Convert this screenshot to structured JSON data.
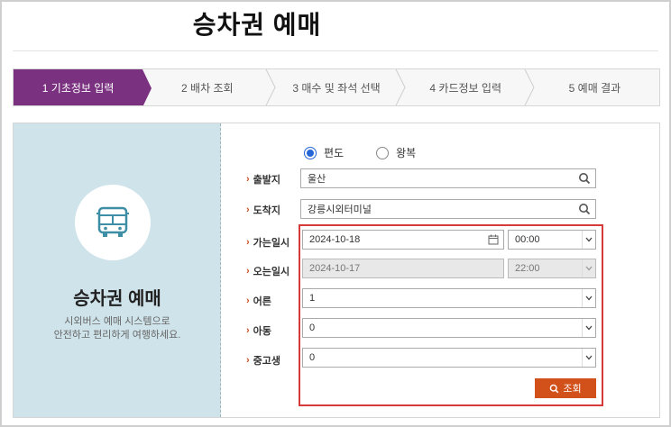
{
  "page": {
    "title": "승차권 예매"
  },
  "steps": [
    {
      "label": "1 기초정보 입력"
    },
    {
      "label": "2 배차 조회"
    },
    {
      "label": "3 매수 및 좌석 선택"
    },
    {
      "label": "4 카드정보 입력"
    },
    {
      "label": "5 예매 결과"
    }
  ],
  "intro": {
    "icon": "bus-icon",
    "title": "승차권 예매",
    "desc_line1": "시외버스 예매 시스템으로",
    "desc_line2": "안전하고 편리하게 여행하세요."
  },
  "trip_type": {
    "one_way": "편도",
    "round_trip": "왕복",
    "selected": "편도"
  },
  "form": {
    "departure": {
      "label": "출발지",
      "value": "울산"
    },
    "arrival": {
      "label": "도착지",
      "value": "강릉시외터미널"
    },
    "go_date": {
      "label": "가는일시",
      "date": "2024-10-18",
      "time": "00:00"
    },
    "return_date": {
      "label": "오는일시",
      "date": "2024-10-17",
      "time": "22:00"
    },
    "adult": {
      "label": "어른",
      "value": "1"
    },
    "child": {
      "label": "아동",
      "value": "0"
    },
    "student": {
      "label": "중고생",
      "value": "0"
    }
  },
  "actions": {
    "search_label": "조회"
  },
  "colors": {
    "accent": "#7a3180",
    "button": "#d2511a",
    "highlight": "#d63a3a",
    "panel_left": "#cfe3ea"
  }
}
